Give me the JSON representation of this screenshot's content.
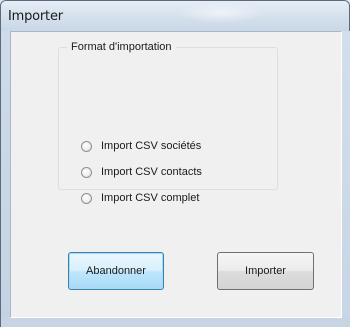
{
  "window": {
    "title": "Importer"
  },
  "group": {
    "legend": "Format d'importation"
  },
  "options": [
    {
      "label": "Import CSV sociétés",
      "selected": false
    },
    {
      "label": "Import CSV contacts",
      "selected": false
    },
    {
      "label": "Import CSV complet",
      "selected": false
    }
  ],
  "buttons": {
    "cancel_label": "Abandonner",
    "import_label": "Importer"
  },
  "colors": {
    "frame": "#cfdbe9",
    "client": "#f0f0f0",
    "default_button": "#bee6fd"
  }
}
